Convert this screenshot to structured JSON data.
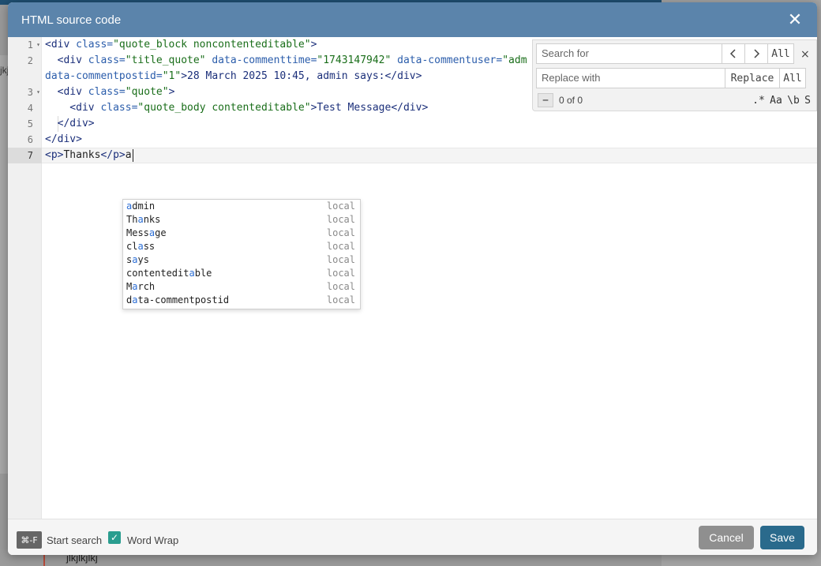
{
  "background": {
    "left_text": "jkj",
    "bottom_text": "jlkjlkjlkj"
  },
  "dialog": {
    "title": "HTML source code",
    "close_icon": "close-icon"
  },
  "editor": {
    "gutter": [
      {
        "num": "1",
        "fold": "▾"
      },
      {
        "num": "2",
        "fold": ""
      },
      {
        "num": "",
        "fold": ""
      },
      {
        "num": "3",
        "fold": "▾"
      },
      {
        "num": "4",
        "fold": ""
      },
      {
        "num": "5",
        "fold": ""
      },
      {
        "num": "6",
        "fold": ""
      },
      {
        "num": "7",
        "fold": ""
      }
    ],
    "lines": [
      [
        "<div ",
        "class=",
        "\"quote_block noncontenteditable\"",
        ">"
      ],
      [
        "  <div ",
        "class=",
        "\"title_quote\" ",
        "data-commenttime=",
        "\"1743147942\" ",
        "data-commentuser=",
        "\"adm"
      ],
      [
        "data-commentpostid=",
        "\"1\"",
        ">28 March 2025 10:45, admin says:</div>"
      ],
      [
        "  <div ",
        "class=",
        "\"quote\"",
        ">"
      ],
      [
        "    <div ",
        "class=",
        "\"quote_body contenteditable\"",
        ">Test Message</div>"
      ],
      [
        "  </div>"
      ],
      [
        "</div>"
      ],
      [
        "<p>",
        "Thanks",
        "</p>",
        "a"
      ]
    ]
  },
  "autocomplete": [
    {
      "pre": "",
      "hl": "a",
      "post": "dmin",
      "meta": "local"
    },
    {
      "pre": "Th",
      "hl": "a",
      "post": "nks",
      "meta": "local"
    },
    {
      "pre": "Mess",
      "hl": "a",
      "post": "ge",
      "meta": "local"
    },
    {
      "pre": "cl",
      "hl": "a",
      "post": "ss",
      "meta": "local"
    },
    {
      "pre": "s",
      "hl": "a",
      "post": "ys",
      "meta": "local"
    },
    {
      "pre": "contentedit",
      "hl": "a",
      "post": "ble",
      "meta": "local"
    },
    {
      "pre": "M",
      "hl": "a",
      "post": "rch",
      "meta": "local"
    },
    {
      "pre": "d",
      "hl": "a",
      "post": "ta-commentpostid",
      "meta": "local"
    }
  ],
  "search": {
    "search_placeholder": "Search for",
    "replace_placeholder": "Replace with",
    "prev_icon": "chevron-left-icon",
    "next_icon": "chevron-right-icon",
    "all_label": "All",
    "replace_label": "Replace",
    "replace_all_label": "All",
    "minus_label": "−",
    "counter": "0 of 0",
    "regex_label": ".*",
    "case_label": "Aa",
    "word_label": "\\b",
    "selection_label": "S",
    "close_label": "×"
  },
  "footer": {
    "shortcut": "⌘-F",
    "start_search": "Start search",
    "word_wrap_checked": true,
    "word_wrap_label": "Word Wrap",
    "cancel_label": "Cancel",
    "save_label": "Save"
  }
}
